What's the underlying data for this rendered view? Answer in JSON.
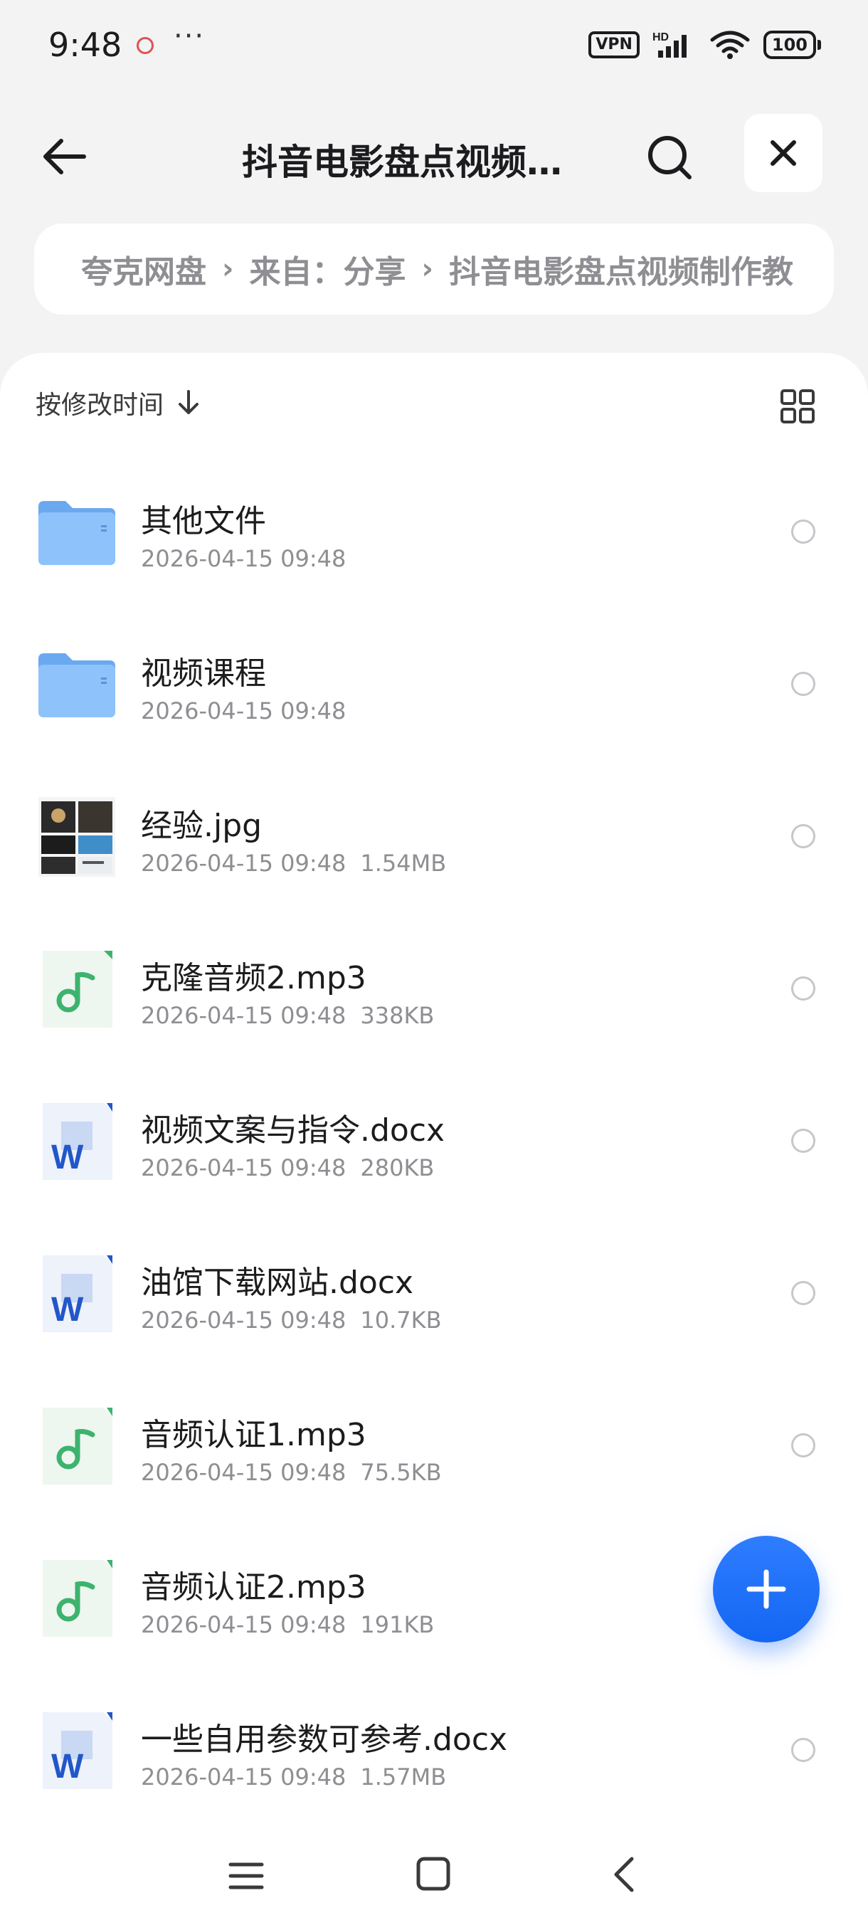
{
  "status_bar": {
    "time": "9:48",
    "dots": "···",
    "vpn": "VPN",
    "hd": "HD",
    "battery": "100"
  },
  "header": {
    "title": "抖音电影盘点视频…"
  },
  "breadcrumb": {
    "items": [
      "夸克网盘",
      "来自：分享",
      "抖音电影盘点视频制作教"
    ]
  },
  "sort": {
    "label": "按修改时间"
  },
  "files": [
    {
      "name": "其他文件",
      "date": "2026-04-15 09:48",
      "size": "",
      "type": "folder"
    },
    {
      "name": "视频课程",
      "date": "2026-04-15 09:48",
      "size": "",
      "type": "folder"
    },
    {
      "name": "经验.jpg",
      "date": "2026-04-15 09:48",
      "size": "1.54MB",
      "type": "image"
    },
    {
      "name": "克隆音频2.mp3",
      "date": "2026-04-15 09:48",
      "size": "338KB",
      "type": "audio"
    },
    {
      "name": "视频文案与指令.docx",
      "date": "2026-04-15 09:48",
      "size": "280KB",
      "type": "word"
    },
    {
      "name": "油馆下载网站.docx",
      "date": "2026-04-15 09:48",
      "size": "10.7KB",
      "type": "word"
    },
    {
      "name": "音频认证1.mp3",
      "date": "2026-04-15 09:48",
      "size": "75.5KB",
      "type": "audio"
    },
    {
      "name": "音频认证2.mp3",
      "date": "2026-04-15 09:48",
      "size": "191KB",
      "type": "audio"
    },
    {
      "name": "一些自用参数可参考.docx",
      "date": "2026-04-15 09:48",
      "size": "1.57MB",
      "type": "word"
    }
  ],
  "icons": {
    "word_letter": "W"
  },
  "colors": {
    "accent": "#1a6ff5",
    "folder": "#7cb6f5",
    "audio": "#3db36e",
    "word": "#2257c9"
  }
}
